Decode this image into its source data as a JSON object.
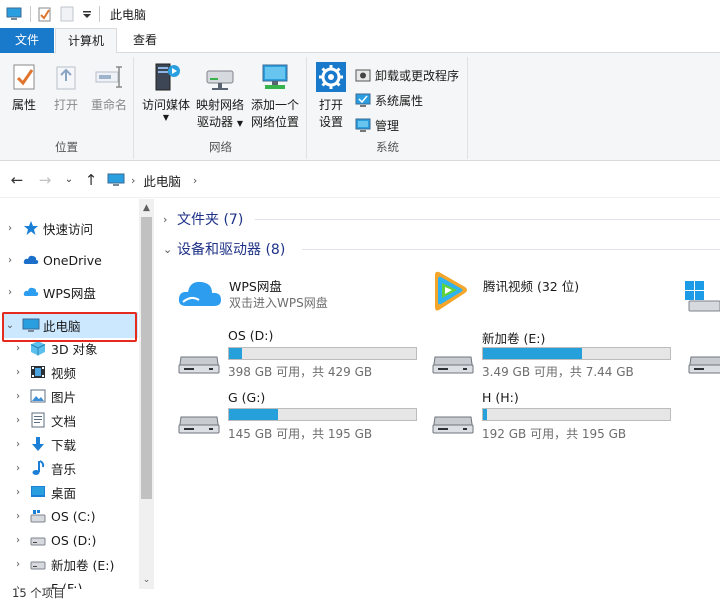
{
  "window": {
    "title": "此电脑"
  },
  "tabs": {
    "file": "文件",
    "computer": "计算机",
    "view": "查看"
  },
  "ribbon": {
    "location": {
      "label": "位置",
      "properties": "属性",
      "open": "打开",
      "rename": "重命名"
    },
    "network": {
      "label": "网络",
      "access_media": "访问媒体",
      "map_drive_1": "映射网络",
      "map_drive_2": "驱动器",
      "add_location_1": "添加一个",
      "add_location_2": "网络位置"
    },
    "system": {
      "label": "系统",
      "open_settings_1": "打开",
      "open_settings_2": "设置",
      "uninstall": "卸载或更改程序",
      "sys_properties": "系统属性",
      "manage": "管理"
    }
  },
  "address": {
    "path": "此电脑"
  },
  "nav": {
    "quick_access": "快速访问",
    "onedrive": "OneDrive",
    "wps": "WPS网盘",
    "this_pc": "此电脑",
    "objects_3d": "3D 对象",
    "videos": "视频",
    "pictures": "图片",
    "documents": "文档",
    "downloads": "下载",
    "music": "音乐",
    "desktop": "桌面",
    "drive_c": "OS (C:)",
    "drive_d": "OS (D:)",
    "drive_e": "新加卷 (E:)",
    "drive_f": "F (F:)"
  },
  "content": {
    "folders_header": "文件夹 (7)",
    "devices_header": "设备和驱动器 (8)",
    "wps": {
      "name": "WPS网盘",
      "sub": "双击进入WPS网盘"
    },
    "tencent": {
      "name": "腾讯视频 (32 位)"
    },
    "drives": [
      {
        "name": "OS (D:)",
        "free": "398 GB 可用，共 429 GB",
        "used_fraction": 0.07
      },
      {
        "name": "新加卷 (E:)",
        "free": "3.49 GB 可用，共 7.44 GB",
        "used_fraction": 0.53
      },
      {
        "name": "G (G:)",
        "free": "145 GB 可用，共 195 GB",
        "used_fraction": 0.26
      },
      {
        "name": "H (H:)",
        "free": "192 GB 可用，共 195 GB",
        "used_fraction": 0.02
      }
    ]
  },
  "status": {
    "items": "15 个项目"
  },
  "colors": {
    "accent": "#1979ca",
    "drive_fill": "#26a0da",
    "selection": "#cce8ff",
    "highlight_box": "#e62b1e",
    "section_title": "#1e3287"
  }
}
